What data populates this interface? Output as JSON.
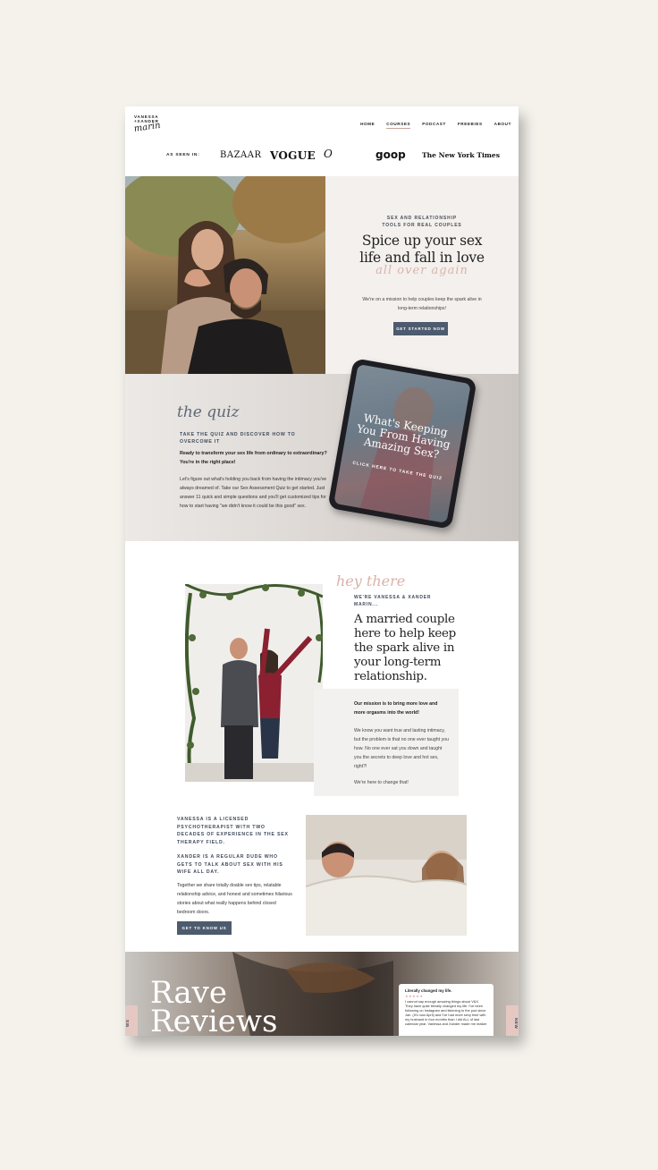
{
  "brand": {
    "line1": "VANESSA",
    "line2": "+XANDER",
    "script": "marin"
  },
  "nav": {
    "items": [
      "HOME",
      "COURSES",
      "PODCAST",
      "FREEBIES",
      "ABOUT"
    ],
    "active": "COURSES"
  },
  "press": {
    "label": "AS SEEN IN:",
    "logos": [
      "BAZAAR",
      "VOGUE",
      "O",
      "goop",
      "The New York Times"
    ]
  },
  "hero": {
    "eyebrow1": "SEX AND RELATIONSHIP",
    "eyebrow2": "TOOLS FOR REAL COUPLES",
    "title1": "Spice up your sex",
    "title2": "life and fall in love",
    "script": "all over again",
    "body": "We're on a mission to help couples keep the spark alive in long-term relationships!",
    "button": "GET STARTED NOW"
  },
  "quiz": {
    "script": "the quiz",
    "heading": "TAKE THE QUIZ AND DISCOVER HOW TO OVERCOME IT",
    "bold": "Ready to transform your sex life from ordinary to extraordinary? You're in the right place!",
    "body": "Let's figure out what's holding you back from having the intimacy you've always dreamed of. Take our Sex Assessment Quiz to get started. Just answer 11 quick and simple questions and you'll get customized tips for how to start having \"we didn't know it could be this good\" sex.",
    "tablet_title": "What's Keeping You From Having Amazing Sex?",
    "tablet_cta": "CLICK HERE TO TAKE THE QUIZ"
  },
  "about": {
    "script": "hey there",
    "eyebrow": "WE'RE VANESSA & XANDER MARIN...",
    "title": "A married couple here to help keep the spark alive in your long-term relationship.",
    "bold": "Our mission is to bring more love and more orgasms into the world!",
    "body": "We know you want true and lasting intimacy, but the problem is that no one ever taught you how. No one ever sat you down and taught you the secrets to deep love and hot sex, right?!",
    "end": "We're here to change that!"
  },
  "bio": {
    "head1": "VANESSA IS A LICENSED PSYCHOTHERAPIST WITH TWO DECADES OF EXPERIENCE IN THE SEX THERAPY FIELD.",
    "head2": "XANDER IS A REGULAR DUDE WHO GETS TO TALK ABOUT SEX WITH HIS WIFE ALL DAY.",
    "body": "Together we share totally doable sex tips, relatable relationship advice, and honest and sometimes hilarious stories about what really happens behind closed bedroom doors.",
    "button": "GET TO KNOW US"
  },
  "reviews": {
    "title1": "Rave",
    "title2": "Reviews",
    "tab_left": "WS",
    "tab_right": "NEW",
    "card_title": "Literally changed my life.",
    "stars": "★★★★★",
    "card_body": "I cannot say enough amazing things about V&X. They have quite literally changed my life. I've been following on Instagram and listening to the pod since Jan. (It's now April) and I've had more sexy time with my husband in four months than I did ALL of last calendar year. Vanessa and Xander made me realize"
  },
  "colors": {
    "accent_blush": "#d8b4ab",
    "button_slate": "#4d5b6e",
    "heading_slate": "#3f4a5c",
    "background": "#f5f2ec"
  }
}
